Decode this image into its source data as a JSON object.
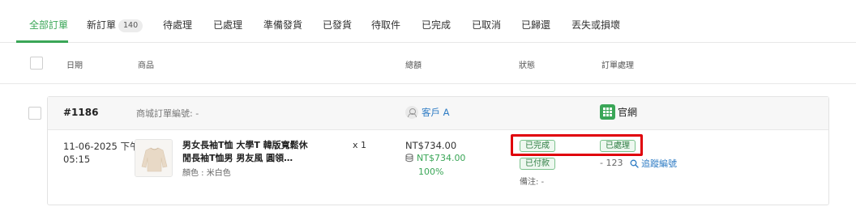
{
  "tabs": [
    {
      "label": "全部訂單"
    },
    {
      "label": "新訂單",
      "count": "140"
    },
    {
      "label": "待處理"
    },
    {
      "label": "已處理"
    },
    {
      "label": "準備發貨"
    },
    {
      "label": "已發貨"
    },
    {
      "label": "待取件"
    },
    {
      "label": "已完成"
    },
    {
      "label": "已取消"
    },
    {
      "label": "已歸還"
    },
    {
      "label": "丟失或損壞"
    }
  ],
  "active_tab": "全部訂單",
  "columns": {
    "date": "日期",
    "product": "商品",
    "total": "總額",
    "status": "狀態",
    "handling": "訂單處理"
  },
  "order": {
    "id": "#1186",
    "shop_ref": "商城訂單編號: -",
    "customer": "客戶 A",
    "channel": "官網",
    "date_line1": "11-06-2025 下午",
    "date_line2": "05:15",
    "product_title": "男女長袖T恤 大學T 韓版寬鬆休閒長袖T恤男 男友風 圓領…",
    "variant": "顏色 : 米白色",
    "quantity": "x 1",
    "total": "NT$734.00",
    "paid_amount": "NT$734.00",
    "paid_percent": "100%",
    "order_status": "已完成",
    "payment_status": "已付款",
    "remark": "備注: -",
    "fulfillment_status": "已處理",
    "tracking_number": "- 123",
    "tracking_link": "追蹤編號"
  },
  "colors": {
    "accent": "#3aa657",
    "link": "#2f7cc4",
    "highlight": "#e0000a"
  },
  "icons": [
    "user-icon",
    "shop-grid-icon",
    "coin-stack-icon",
    "search-icon"
  ]
}
